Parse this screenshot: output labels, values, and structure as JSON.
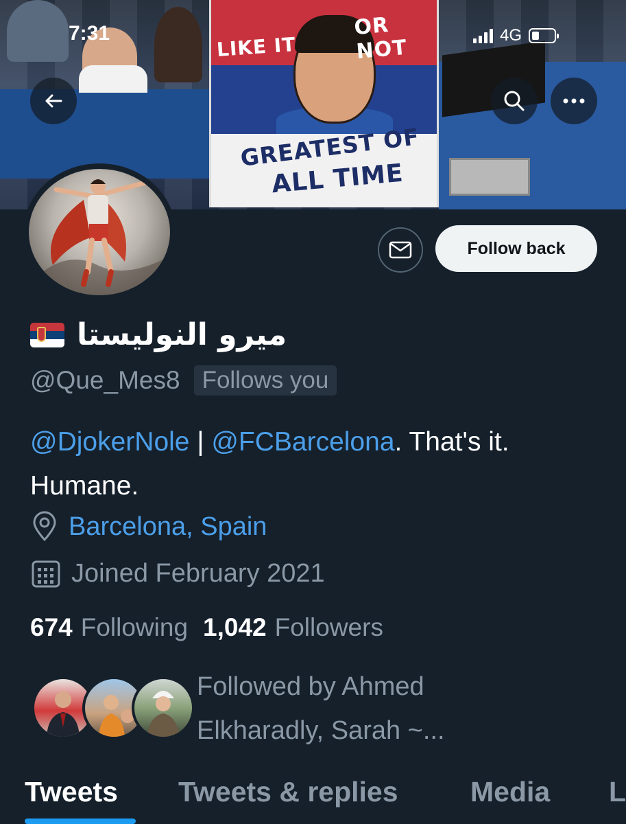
{
  "status_bar": {
    "time": "7:31",
    "network": "4G"
  },
  "banner": {
    "flag_text_top_left": "LIKE IT",
    "flag_text_top_right": "OR NOT",
    "flag_text_bottom_1": "GREATEST OF",
    "flag_text_bottom_2": "ALL TIME"
  },
  "header_icons": {
    "back": "arrow-left-icon",
    "search": "search-icon",
    "more": "more-icon"
  },
  "profile": {
    "display_name": "ميرو النوليستا",
    "handle": "@Que_Mes8",
    "follows_you": "Follows you",
    "follow_button": "Follow back",
    "bio": {
      "mention1": "@DjokerNole",
      "separator": " | ",
      "mention2": "@FCBarcelona",
      "rest": ". That's it. Humane."
    },
    "location": "Barcelona, Spain",
    "joined": "Joined February 2021",
    "following_count": "674",
    "following_label": "Following",
    "followers_count": "1,042",
    "followers_label": "Followers",
    "followed_by": "Followed by Ahmed Elkharadly, Sarah ~..."
  },
  "tabs": [
    {
      "label": "Tweets",
      "active": true
    },
    {
      "label": "Tweets & replies",
      "active": false
    },
    {
      "label": "Media",
      "active": false
    },
    {
      "label": "L",
      "active": false
    }
  ],
  "colors": {
    "background": "#15202b",
    "link": "#4c9fe9",
    "secondary_text": "#8b98a5",
    "tab_indicator": "#1d9bf0"
  }
}
